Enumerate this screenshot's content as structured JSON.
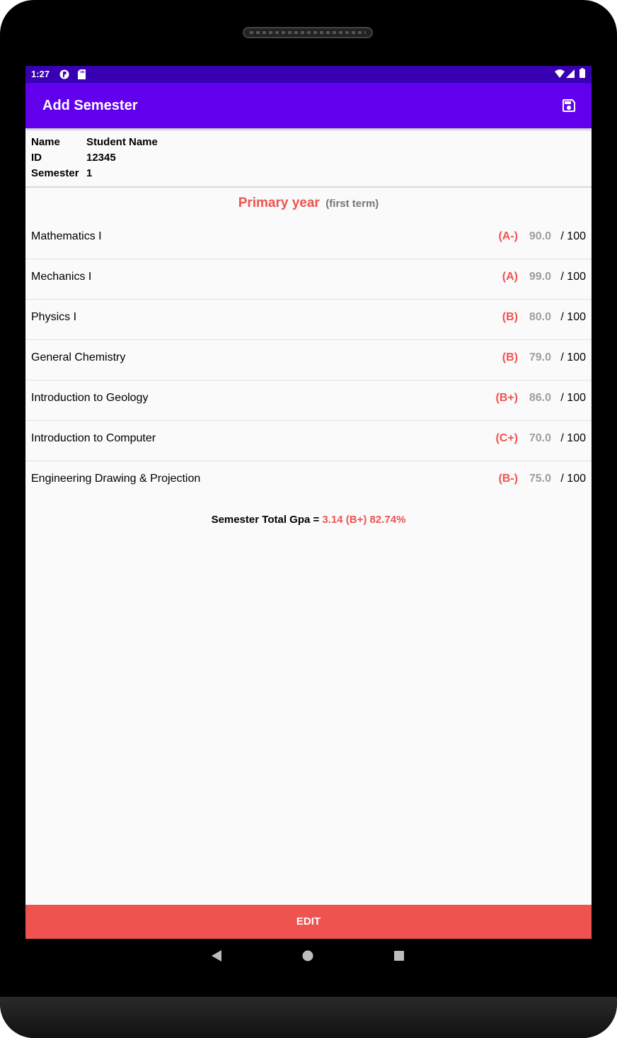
{
  "status_bar": {
    "time": "1:27"
  },
  "app_bar": {
    "title": "Add Semester"
  },
  "student": {
    "name_label": "Name",
    "name_value": "Student Name",
    "id_label": "ID",
    "id_value": "12345",
    "semester_label": "Semester",
    "semester_value": "1"
  },
  "term": {
    "title": "Primary year",
    "subtitle": "(first term)"
  },
  "courses": [
    {
      "name": "Mathematics I",
      "grade": "(A-)",
      "score": "90.0",
      "max": "/ 100"
    },
    {
      "name": "Mechanics I",
      "grade": "(A)",
      "score": "99.0",
      "max": "/ 100"
    },
    {
      "name": "Physics I",
      "grade": "(B)",
      "score": "80.0",
      "max": "/ 100"
    },
    {
      "name": "General Chemistry",
      "grade": "(B)",
      "score": "79.0",
      "max": "/ 100"
    },
    {
      "name": "Introduction to Geology",
      "grade": "(B+)",
      "score": "86.0",
      "max": "/ 100"
    },
    {
      "name": "Introduction to Computer",
      "grade": "(C+)",
      "score": "70.0",
      "max": "/ 100"
    },
    {
      "name": "Engineering Drawing & Projection",
      "grade": "(B-)",
      "score": "75.0",
      "max": "/ 100"
    }
  ],
  "total": {
    "label": "Semester Total Gpa = ",
    "value": "3.14 (B+) 82.74%"
  },
  "edit_button": {
    "label": "EDIT"
  },
  "colors": {
    "status_bar": "#3700b3",
    "app_bar": "#6200ee",
    "accent_red": "#ef5350",
    "score_gray": "#9e9e9e",
    "background": "#fafafa"
  },
  "icons": [
    "save-icon",
    "back-nav-icon",
    "home-nav-icon",
    "recents-nav-icon",
    "wifi-icon",
    "signal-icon",
    "battery-icon",
    "sd-card-icon",
    "shield-icon"
  ]
}
